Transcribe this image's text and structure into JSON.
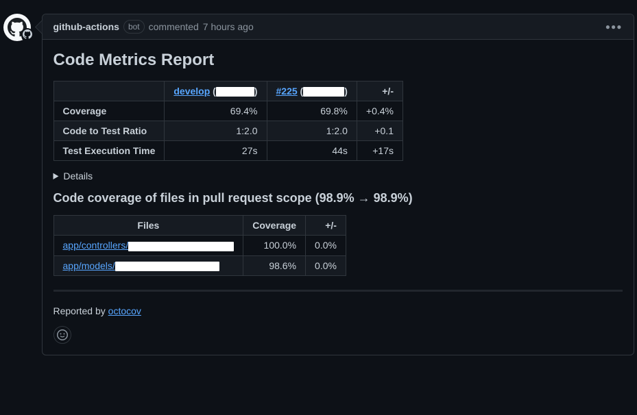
{
  "header": {
    "author": "github-actions",
    "bot_label": "bot",
    "action": "commented",
    "timestamp": "7 hours ago"
  },
  "report": {
    "title": "Code Metrics Report",
    "metrics": {
      "diff_header": "+/-",
      "col1": {
        "link": "develop"
      },
      "col2": {
        "link": "#225"
      },
      "rows": [
        {
          "label": "Coverage",
          "v1": "69.4%",
          "v2": "69.8%",
          "diff": "+0.4%"
        },
        {
          "label": "Code to Test Ratio",
          "v1": "1:2.0",
          "v2": "1:2.0",
          "diff": "+0.1"
        },
        {
          "label": "Test Execution Time",
          "v1": "27s",
          "v2": "44s",
          "diff": "+17s"
        }
      ]
    },
    "details_label": "Details",
    "scope_heading": "Code coverage of files in pull request scope (98.9% → 98.9%)",
    "files_table": {
      "files_header": "Files",
      "coverage_header": "Coverage",
      "diff_header": "+/-",
      "rows": [
        {
          "file_prefix": "app/controllers/",
          "coverage": "100.0%",
          "diff": "0.0%"
        },
        {
          "file_prefix": "app/models/",
          "coverage": "98.6%",
          "diff": "0.0%"
        }
      ]
    },
    "footer_prefix": "Reported by ",
    "footer_link": "octocov"
  }
}
